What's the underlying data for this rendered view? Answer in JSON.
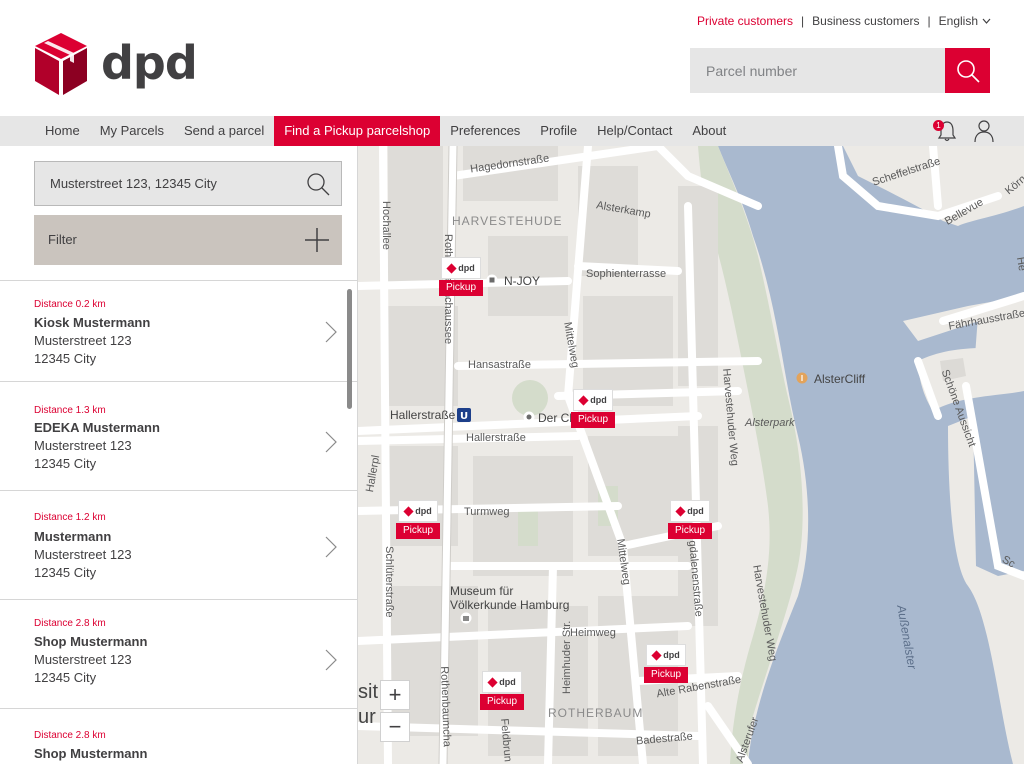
{
  "header": {
    "logo_text": "dpd",
    "top_links": [
      {
        "label": "Private customers",
        "active": true
      },
      {
        "label": "Business customers",
        "active": false
      }
    ],
    "language": "English",
    "search_placeholder": "Parcel number"
  },
  "nav": {
    "items": [
      "Home",
      "My Parcels",
      "Send a parcel",
      "Find a Pickup parcelshop",
      "Preferences",
      "Profile",
      "Help/Contact",
      "About"
    ],
    "active_index": 3,
    "notification_count": "1"
  },
  "panel": {
    "address_value": "Musterstreet 123, 12345 City",
    "filter_label": "Filter",
    "shops": [
      {
        "distance": "Distance 0.2 km",
        "name": "Kiosk Mustermann",
        "street": "Musterstreet 123",
        "city": "12345 City"
      },
      {
        "distance": "Distance 1.3 km",
        "name": "EDEKA Mustermann",
        "street": "Musterstreet 123",
        "city": "12345 City"
      },
      {
        "distance": "Distance 1.2 km",
        "name": "Mustermann",
        "street": "Musterstreet 123",
        "city": "12345 City"
      },
      {
        "distance": "Distance 2.8 km",
        "name": "Shop Mustermann",
        "street": "Musterstreet 123",
        "city": "12345 City"
      },
      {
        "distance": "Distance 2.8 km",
        "name": "Shop Mustermann",
        "street": "",
        "city": ""
      }
    ]
  },
  "map": {
    "pin_logo": "dpd",
    "pin_label": "Pickup",
    "zoom_in": "+",
    "zoom_out": "−",
    "labels": {
      "hagedornstrasse": "Hagedornstraße",
      "harvestehude": "HARVESTEHUDE",
      "alsterkamp": "Alsterkamp",
      "hochallee": "Hochallee",
      "njoy": "N-JOY",
      "sophienterrasse": "Sophienterrasse",
      "hansastrasse": "Hansastraße",
      "mittelweg1": "Mittelweg",
      "hallerstrasse1": "Hallerstraße",
      "der_club": "Der Cl     r Alster",
      "hallerstrasse2": "Hallerstraße",
      "alstercliff": "AlsterCliff",
      "alsterpark": "Alsterpark",
      "harvestehuder_weg1": "Harvestehuder Weg",
      "turmweg": "Turmweg",
      "museum1": "Museum für",
      "museum2": "Völkerkunde Hamburg",
      "heimweg": "Heimweg",
      "mittelweg2": "Mittelweg",
      "aussenalster": "Außenalster",
      "schefflestrasse": "Scheffelstraße",
      "bellevue": "Bellevue",
      "fahrhausstrasse": "Fährhausstraße",
      "schoene_aussicht": "Schöne Aussicht",
      "rotherbaum": "ROTHERBAUM",
      "alte_rabenstrasse": "Alte Rabenstraße",
      "badestrasse": "Badestraße",
      "rothenbaumchaussee1": "Rothenbaumchaussee",
      "rothenbaumchaussee2": "Rothenbaumcha",
      "schlueterstrasse": "Schlüterstraße",
      "heimhuder": "Heimhuder Str.",
      "magdalenenstrasse": "gdalenenstraße",
      "harvestehuder_weg2": "Harvestehuder Weg",
      "hallerpl": "Hallerpl",
      "feldbrunnen": "Feldbrun",
      "alsterufer": "Alsterufer",
      "koernerstr": "Körner",
      "he": "He",
      "sc": "Sc",
      "sit": "sit",
      "ur": "ur"
    }
  }
}
